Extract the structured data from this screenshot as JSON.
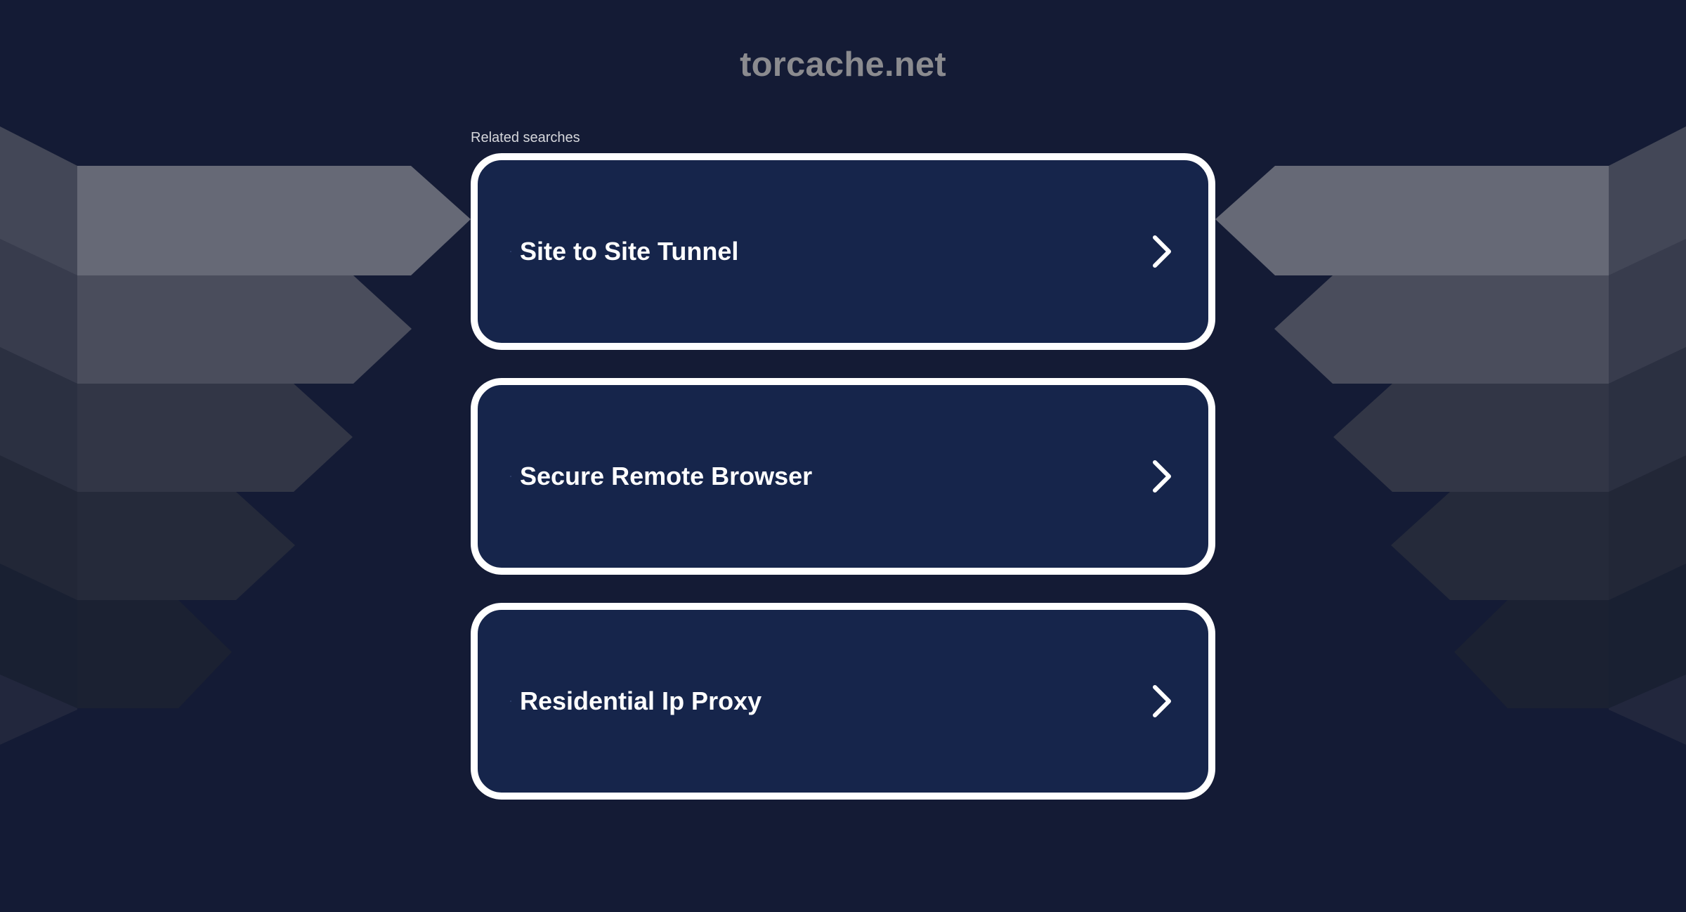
{
  "header": {
    "domain": "torcache.net"
  },
  "related": {
    "label": "Related searches",
    "items": [
      {
        "label": "Site to Site Tunnel"
      },
      {
        "label": "Secure Remote Browser"
      },
      {
        "label": "Residential Ip Proxy"
      }
    ]
  },
  "colors": {
    "background": "#141b35",
    "card": "#16254b",
    "card_border": "#ffffff",
    "title": "#8b8b8f"
  },
  "icons": {
    "result_arrow": "chevron-right-icon"
  }
}
